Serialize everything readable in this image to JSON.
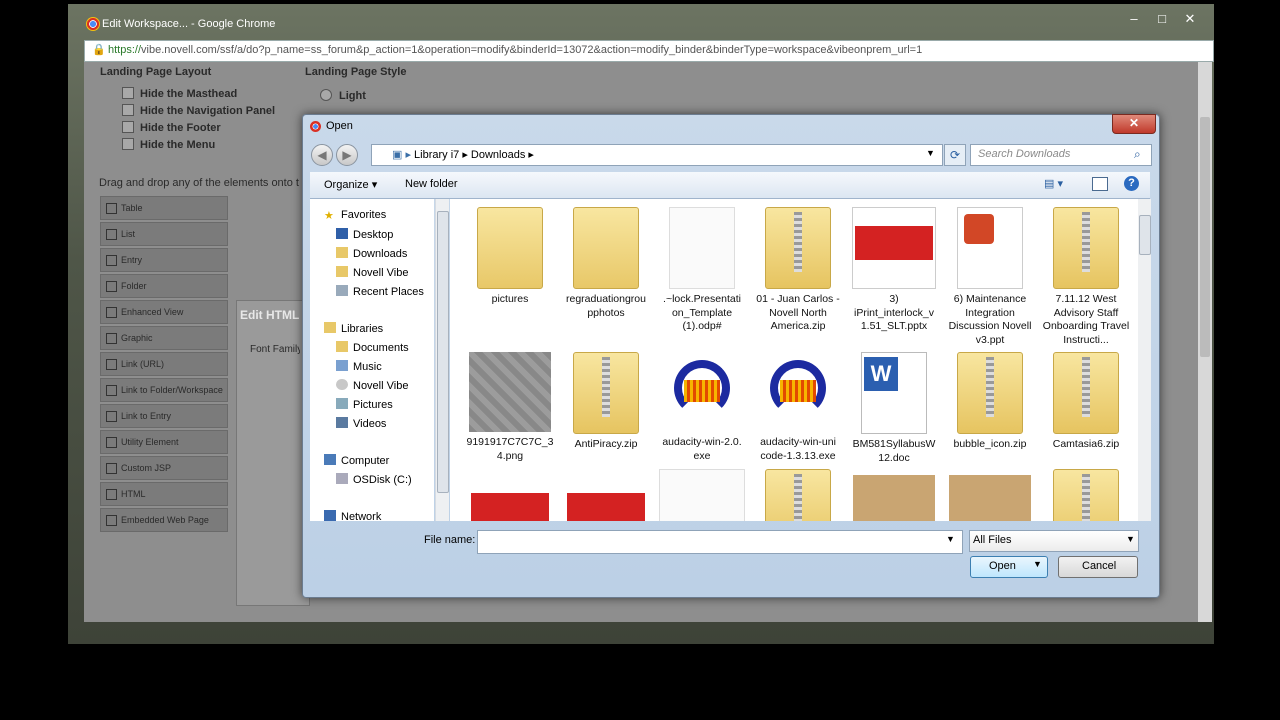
{
  "browser": {
    "title": "Edit Workspace... - Google Chrome",
    "url_scheme": "https://",
    "url_rest": "vibe.novell.com/ssf/a/do?p_name=ss_forum&p_action=1&operation=modify&binderId=13072&action=modify_binder&binderType=workspace&vibeonprem_url=1",
    "controls": {
      "minimize": "–",
      "maximize": "□",
      "close": "✕"
    }
  },
  "background_page": {
    "landing_layout_title": "Landing Page Layout",
    "landing_style_title": "Landing Page Style",
    "layout_options": [
      "Hide the Masthead",
      "Hide the Navigation Panel",
      "Hide the Footer",
      "Hide the Menu"
    ],
    "style_options": [
      "Light"
    ],
    "drag_hint": "Drag and drop any of the elements onto t",
    "palette": [
      "Table",
      "List",
      "Entry",
      "Folder",
      "Enhanced View",
      "Graphic",
      "Link (URL)",
      "Link to Folder/Workspace",
      "Link to Entry",
      "Utility Element",
      "Custom JSP",
      "HTML",
      "Embedded Web Page"
    ],
    "edit_html_title": "Edit HTML",
    "font_family_label": "Font Family"
  },
  "dialog": {
    "title": "Open",
    "close_label": "✕",
    "breadcrumb": [
      "Library i7",
      "Downloads"
    ],
    "search_placeholder": "Search Downloads",
    "toolbar": {
      "organize": "Organize ▾",
      "new_folder": "New folder"
    },
    "nav": {
      "favorites": {
        "label": "Favorites",
        "items": [
          "Desktop",
          "Downloads",
          "Novell Vibe",
          "Recent Places"
        ]
      },
      "libraries": {
        "label": "Libraries",
        "items": [
          "Documents",
          "Music",
          "Novell Vibe",
          "Pictures",
          "Videos"
        ]
      },
      "computer": {
        "label": "Computer",
        "items": [
          "OSDisk (C:)"
        ]
      },
      "network": {
        "label": "Network"
      }
    },
    "files": [
      {
        "name": "pictures",
        "kind": "folder"
      },
      {
        "name": "regraduationgrou pphotos",
        "kind": "folder"
      },
      {
        "name": ".~lock.Presentati on_Template (1).odp#",
        "kind": "doc"
      },
      {
        "name": "01 - Juan Carlos - Novell North America.zip",
        "kind": "zip"
      },
      {
        "name": "3) iPrint_interlock_v 1.51_SLT.pptx",
        "kind": "slide"
      },
      {
        "name": "6) Maintenance Integration Discussion Novell v3.ppt",
        "kind": "ppt"
      },
      {
        "name": "7.11.12 West Advisory Staff Onboarding Travel Instructi...",
        "kind": "zip"
      },
      {
        "name": "9191917C7C7C_3 4.png",
        "kind": "png"
      },
      {
        "name": "AntiPiracy.zip",
        "kind": "zip"
      },
      {
        "name": "audacity-win-2.0. exe",
        "kind": "aud"
      },
      {
        "name": "audacity-win-uni code-1.3.13.exe",
        "kind": "aud"
      },
      {
        "name": "BM581SyllabusW 12.doc",
        "kind": "word"
      },
      {
        "name": "bubble_icon.zip",
        "kind": "zip"
      },
      {
        "name": "Camtasia6.zip",
        "kind": "zip"
      },
      {
        "name": "",
        "kind": "redcard"
      },
      {
        "name": "",
        "kind": "redcard"
      },
      {
        "name": "",
        "kind": "java"
      },
      {
        "name": "",
        "kind": "zip"
      },
      {
        "name": "",
        "kind": "brown"
      },
      {
        "name": "",
        "kind": "brown"
      },
      {
        "name": "",
        "kind": "zip"
      }
    ],
    "file_name_label": "File name:",
    "file_name_value": "",
    "filter_value": "All Files",
    "open_label": "Open",
    "cancel_label": "Cancel"
  }
}
